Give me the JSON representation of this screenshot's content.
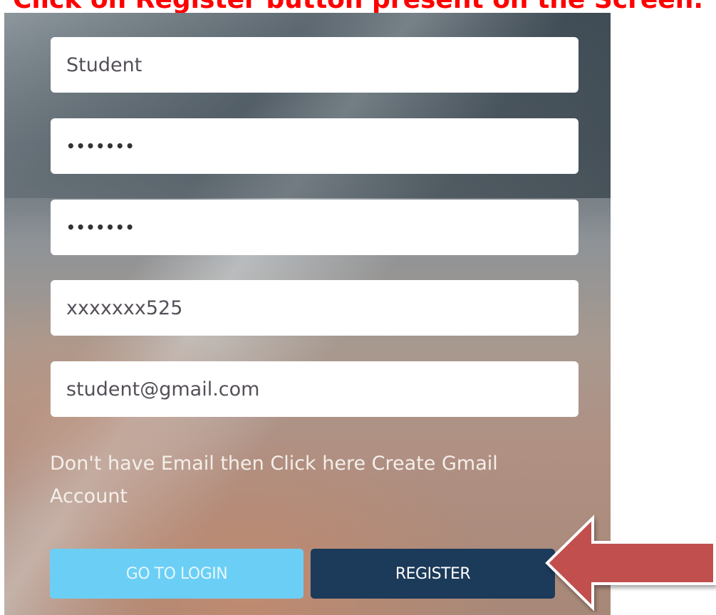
{
  "caption": "Click on Register button present on the Screen.",
  "form": {
    "username_value": "Student",
    "password_value": "•••••••",
    "confirm_password_value": "•••••••",
    "mobile_value": "xxxxxxx525",
    "email_value": "student@gmail.com",
    "email_help_line1": "Don't have Email then Click here Create Gmail",
    "email_help_line2": "Account"
  },
  "buttons": {
    "go_to_login": "GO TO LOGIN",
    "register": "REGISTER"
  },
  "colors": {
    "caption": "#ff0000",
    "login_button": "#6bcff5",
    "register_button": "#1c3a5a",
    "arrow": "#c0504d"
  },
  "icons": {
    "pointer": "left-arrow-icon"
  }
}
